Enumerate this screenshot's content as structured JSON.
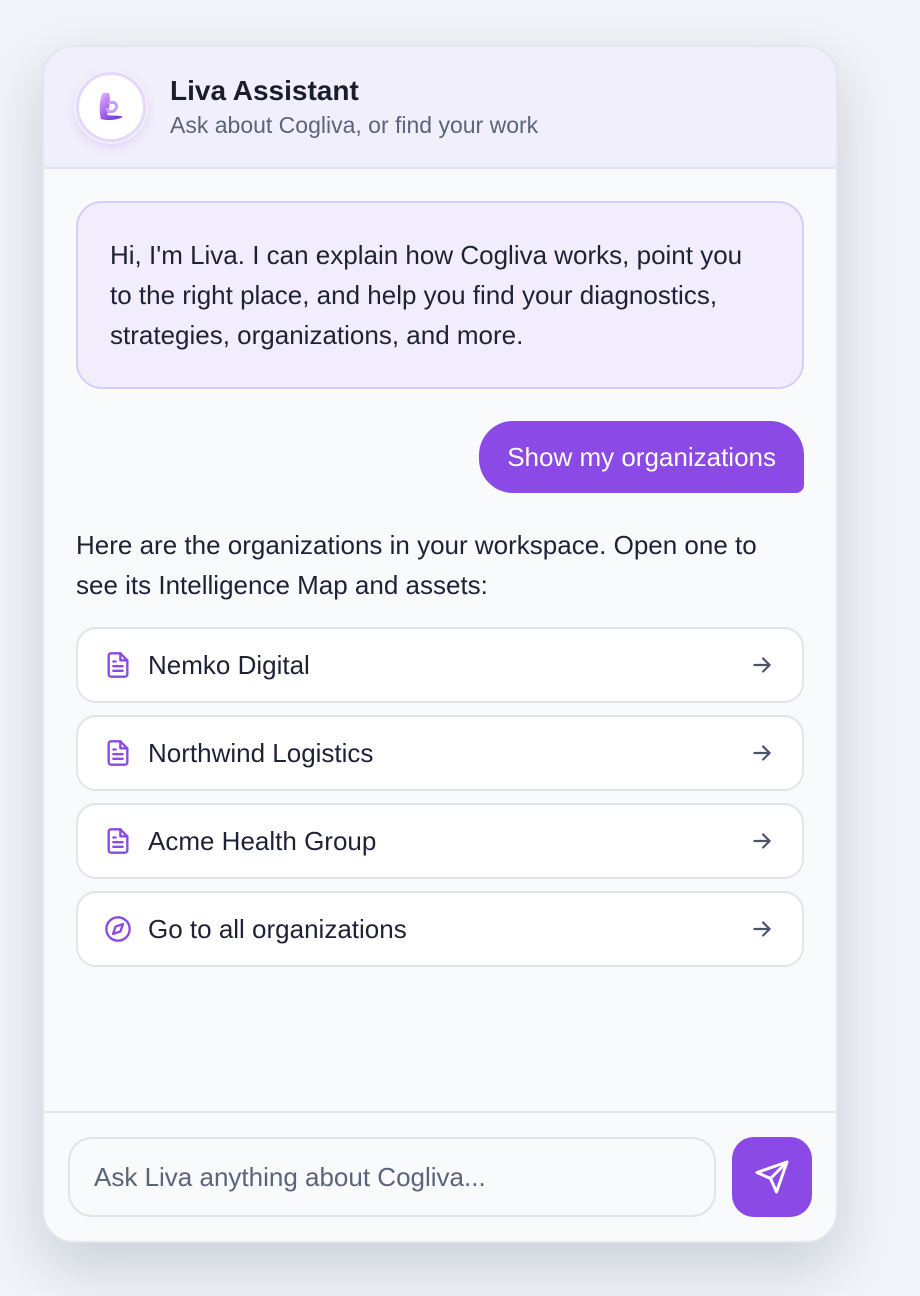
{
  "header": {
    "title": "Liva Assistant",
    "subtitle": "Ask about Cogliva, or find your work",
    "avatar_icon": "liva-logo"
  },
  "conversation": {
    "greeting": "Hi, I'm Liva. I can explain how Cogliva works, point you to the right place, and help you find your diagnostics, strategies, organizations, and more.",
    "user_message": "Show my organizations",
    "assistant_reply": "Here are the organizations in your workspace. Open one to see its Intelligence Map and assets:",
    "links": [
      {
        "label": "Nemko Digital",
        "icon": "document-icon"
      },
      {
        "label": "Northwind Logistics",
        "icon": "document-icon"
      },
      {
        "label": "Acme Health Group",
        "icon": "document-icon"
      },
      {
        "label": "Go to all organizations",
        "icon": "compass-icon"
      }
    ]
  },
  "composer": {
    "placeholder": "Ask Liva anything about Cogliva...",
    "send_icon": "send-icon"
  },
  "colors": {
    "accent": "#8b4ae6",
    "header_bg": "#f1effb",
    "bubble_bg": "#f1edfc"
  }
}
